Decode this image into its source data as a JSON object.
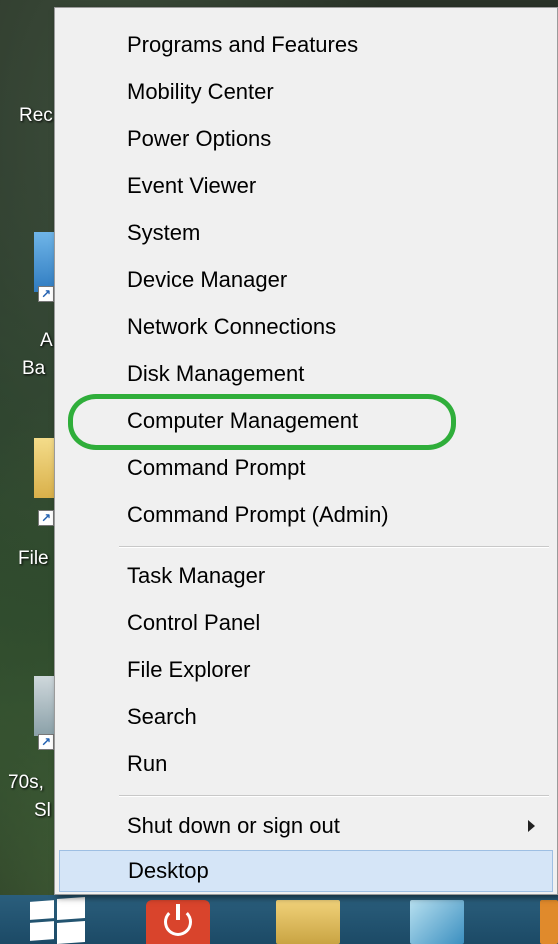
{
  "desktop": {
    "labels": [
      "Rec",
      "A",
      "Ba",
      "File",
      "70s,",
      "Sl"
    ]
  },
  "menu": {
    "items": [
      {
        "label": "Programs and Features"
      },
      {
        "label": "Mobility Center"
      },
      {
        "label": "Power Options"
      },
      {
        "label": "Event Viewer"
      },
      {
        "label": "System"
      },
      {
        "label": "Device Manager"
      },
      {
        "label": "Network Connections"
      },
      {
        "label": "Disk Management"
      },
      {
        "label": "Computer Management"
      },
      {
        "label": "Command Prompt"
      },
      {
        "label": "Command Prompt (Admin)"
      },
      {
        "label": "Task Manager"
      },
      {
        "label": "Control Panel"
      },
      {
        "label": "File Explorer"
      },
      {
        "label": "Search"
      },
      {
        "label": "Run"
      },
      {
        "label": "Shut down or sign out"
      },
      {
        "label": "Desktop"
      }
    ]
  },
  "colors": {
    "annotation": "#2fae3a",
    "hover_bg": "#d5e5f7",
    "menu_bg": "#f0f0f0"
  }
}
